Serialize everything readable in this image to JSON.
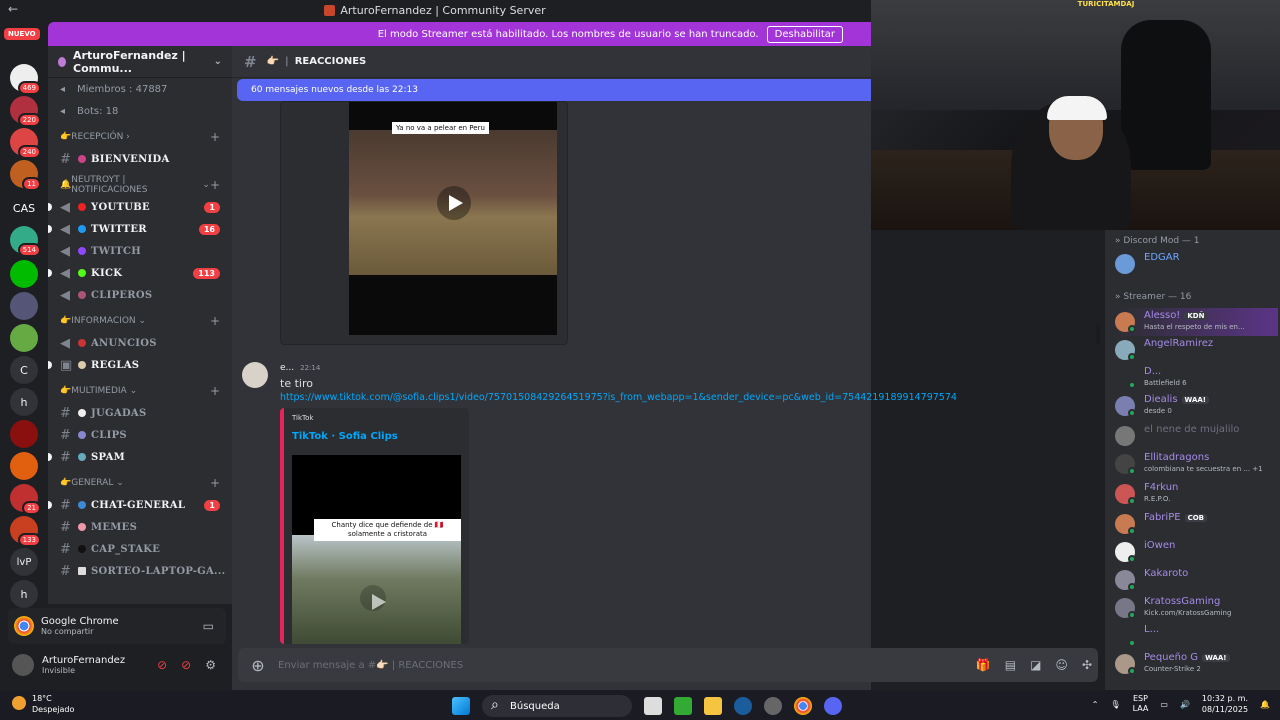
{
  "window": {
    "title": "ArturoFernandez | Community Server"
  },
  "banner": {
    "text": "El modo Streamer está habilitado. Los nombres de usuario se han truncado.",
    "button": "Deshabilitar"
  },
  "rail": {
    "new_label": "NUEVO",
    "badges": [
      "469",
      "220",
      "240",
      "11",
      "514",
      "21",
      "133"
    ],
    "text_items": [
      "CAS",
      "C",
      "h",
      "lvP",
      "h"
    ]
  },
  "server": {
    "name": "ArturoFernandez | Commu...",
    "stats": {
      "members": "Miembros : 47887",
      "bots": "Bots: 18"
    },
    "categories": [
      {
        "name": "RECEPCIÓN",
        "channels": [
          {
            "name": "BIENVENIDA"
          }
        ]
      },
      {
        "name": "NEUTROYT | NOTIFICACIONES",
        "channels": [
          {
            "name": "YOUTUBE",
            "count": "1"
          },
          {
            "name": "TWITTER",
            "count": "16"
          },
          {
            "name": "TWITCH"
          },
          {
            "name": "KICK",
            "count": "113"
          },
          {
            "name": "CLIPEROS"
          }
        ]
      },
      {
        "name": "INFORMACION",
        "channels": [
          {
            "name": "ANUNCIOS"
          },
          {
            "name": "REGLAS"
          }
        ]
      },
      {
        "name": "MULTIMEDIA",
        "channels": [
          {
            "name": "JUGADAS"
          },
          {
            "name": "CLIPS"
          },
          {
            "name": "SPAM"
          }
        ]
      },
      {
        "name": "GENERAL",
        "channels": [
          {
            "name": "CHAT-GENERAL",
            "count": "1"
          },
          {
            "name": "MEMES"
          },
          {
            "name": "CAP_STAKE"
          },
          {
            "name": "SORTEO-LAPTOP-GA..."
          }
        ]
      }
    ]
  },
  "voice": {
    "app": "Google Chrome",
    "status": "No compartir"
  },
  "user": {
    "name": "ArturoFernandez",
    "status": "Invisible"
  },
  "channel": {
    "name": "REACCIONES",
    "new_messages": "60 mensajes nuevos desde las 22:13"
  },
  "video1": {
    "caption": "Ya no va a pelear en Peru"
  },
  "message": {
    "author": "e...",
    "time": "22:14",
    "text": "te tiro",
    "link": "https://www.tiktok.com/@sofia.clips1/video/7570150842926451975?is_from_webapp=1&sender_device=pc&web_id=7544219189914797574"
  },
  "embed": {
    "provider": "TikTok",
    "title": "TikTok · Sofia Clips",
    "caption": "Chanty dice que defiende de 🇵🇪 solamente a cristorata"
  },
  "composer": {
    "placeholder": "Enviar mensaje a #👉🏻 | REACCIONES"
  },
  "stream": {
    "logo": "TURICITAMDAJ"
  },
  "members": {
    "groups": [
      {
        "label": "Discord Mod — 1"
      },
      {
        "label": "Streamer — 16"
      }
    ],
    "list": [
      {
        "name": "EDGAR",
        "sub": ""
      },
      {
        "name": "Alesso!",
        "tag": "KDÑ",
        "sub": "Hasta el respeto de mis en..."
      },
      {
        "name": "AngelRamirez",
        "sub": ""
      },
      {
        "name": "D...",
        "sub": "Battlefield 6"
      },
      {
        "name": "Diealis",
        "tag": "WAA!",
        "sub": "desde 0"
      },
      {
        "name": "el nene de mujalilo",
        "sub": ""
      },
      {
        "name": "Ellitadragons",
        "sub": "colombiana te secuestra en ... +1"
      },
      {
        "name": "F4rkun",
        "sub": "R.E.P.O."
      },
      {
        "name": "FabriPE",
        "tag": "COB",
        "sub": ""
      },
      {
        "name": "iOwen",
        "sub": ""
      },
      {
        "name": "Kakaroto",
        "sub": ""
      },
      {
        "name": "KratossGaming",
        "sub": "Kick.com/KratossGaming"
      },
      {
        "name": "L...",
        "sub": ""
      },
      {
        "name": "Pequeño G",
        "tag": "WAA!",
        "sub": "Counter-Strike 2"
      }
    ]
  },
  "taskbar": {
    "temp": "18°C",
    "weather": "Despejado",
    "search": "Búsqueda",
    "lang1": "ESP",
    "lang2": "LAA",
    "time": "10:32 p. m.",
    "date": "08/11/2025"
  }
}
